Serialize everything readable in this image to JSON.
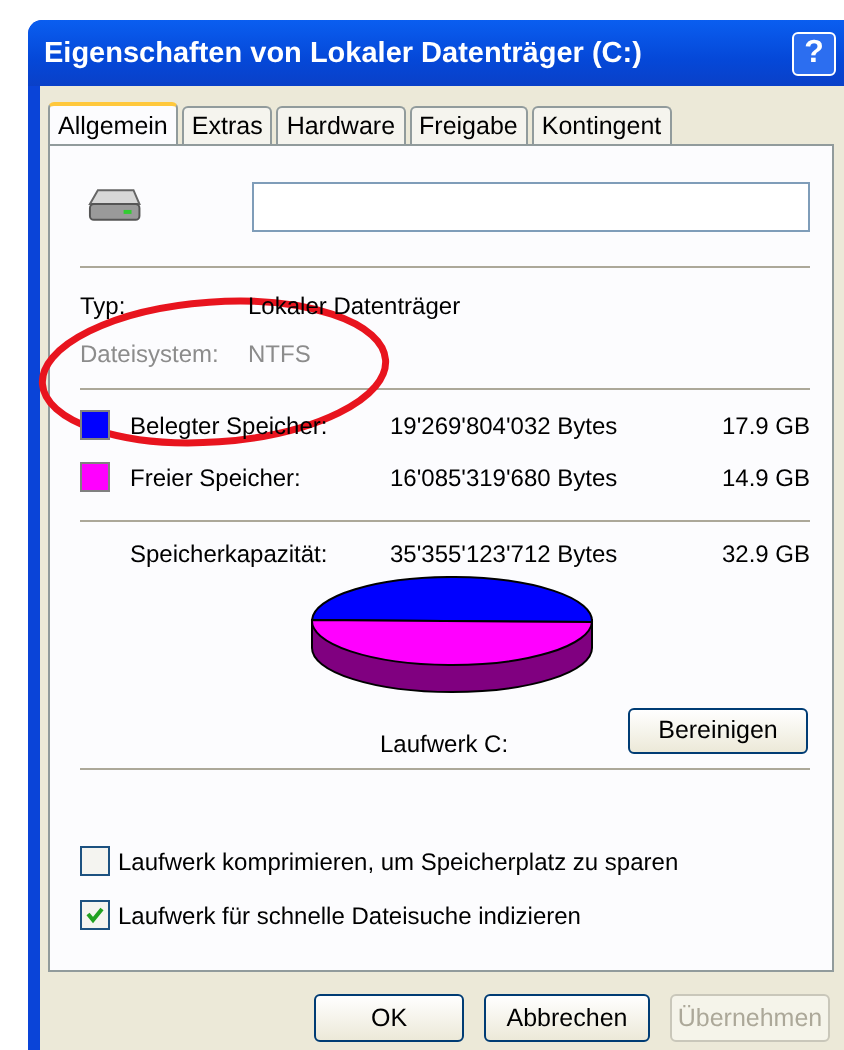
{
  "window": {
    "title": "Eigenschaften von Lokaler Datenträger (C:)",
    "help_button": "?"
  },
  "tabs": [
    {
      "label": "Allgemein",
      "selected": true
    },
    {
      "label": "Extras",
      "selected": false
    },
    {
      "label": "Hardware",
      "selected": false
    },
    {
      "label": "Freigabe",
      "selected": false
    },
    {
      "label": "Kontingent",
      "selected": false
    }
  ],
  "info": [
    {
      "label": "Typ:",
      "value": "Lokaler Datenträger"
    },
    {
      "label": "Dateisystem:",
      "value": "NTFS"
    }
  ],
  "usage": [
    {
      "label": "Belegter Speicher:",
      "bytes": "19'269'804'032 Bytes",
      "size": "17.9 GB",
      "color": "#0000ff"
    },
    {
      "label": "Freier Speicher:",
      "bytes": "16'085'319'680 Bytes",
      "size": "14.9 GB",
      "color": "#ff00ff"
    }
  ],
  "capacity": {
    "label": "Speicherkapazität:",
    "bytes": "35'355'123'712 Bytes",
    "size": "32.9 GB"
  },
  "drive_label": "Laufwerk C:",
  "cleanup_button": "Bereinigen",
  "options": [
    {
      "label": "Laufwerk komprimieren, um Speicherplatz zu sparen",
      "checked": false
    },
    {
      "label": "Laufwerk für schnelle Dateisuche indizieren",
      "checked": true
    }
  ],
  "buttons": [
    {
      "label": "OK",
      "disabled": false
    },
    {
      "label": "Abbrechen",
      "disabled": false
    },
    {
      "label": "Übernehmen",
      "disabled": true
    }
  ]
}
